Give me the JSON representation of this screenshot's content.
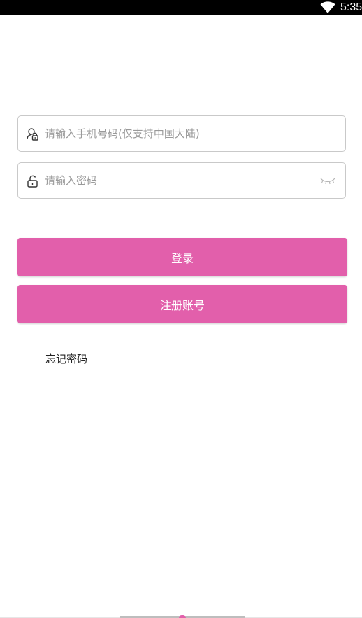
{
  "status_bar": {
    "time": "5:35",
    "wifi_icon": "wifi-icon"
  },
  "login_form": {
    "phone_field": {
      "icon": "user-lock-icon",
      "value": "",
      "placeholder": "请输入手机号码(仅支持中国大陆)"
    },
    "password_field": {
      "icon": "unlock-icon",
      "value": "",
      "placeholder": "请输入密码",
      "toggle_icon": "eye-closed-icon"
    },
    "login_button_label": "登录",
    "register_button_label": "注册账号",
    "forgot_password_label": "忘记密码"
  },
  "colors": {
    "accent": "#e25fab",
    "status_bar_bg": "#000000",
    "field_border": "#c9c9c9",
    "placeholder_text": "#9a9a9a"
  }
}
